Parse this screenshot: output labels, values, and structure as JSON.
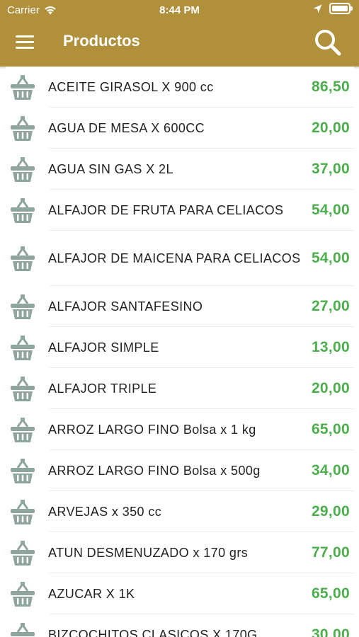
{
  "status_bar": {
    "carrier": "Carrier",
    "time": "8:44 PM"
  },
  "navbar": {
    "title": "Productos",
    "menu_icon": "hamburger-menu-icon",
    "search_icon": "search-icon"
  },
  "colors": {
    "header": "#b1903c",
    "price": "#4cae4c",
    "basket_icon": "#8fa59f"
  },
  "products": [
    {
      "name": "ACEITE GIRASOL X 900 cc",
      "price": "86,50"
    },
    {
      "name": "AGUA DE MESA X 600CC",
      "price": "20,00"
    },
    {
      "name": "AGUA SIN GAS X 2L",
      "price": "37,00"
    },
    {
      "name": "ALFAJOR DE FRUTA PARA CELIACOS",
      "price": "54,00"
    },
    {
      "name": "ALFAJOR DE MAICENA PARA CELIACOS",
      "price": "54,00"
    },
    {
      "name": "ALFAJOR SANTAFESINO",
      "price": "27,00"
    },
    {
      "name": "ALFAJOR SIMPLE",
      "price": "13,00"
    },
    {
      "name": "ALFAJOR TRIPLE",
      "price": "20,00"
    },
    {
      "name": "ARROZ LARGO FINO Bolsa x 1 kg",
      "price": "65,00"
    },
    {
      "name": "ARROZ LARGO FINO Bolsa x 500g",
      "price": "34,00"
    },
    {
      "name": "ARVEJAS x 350 cc",
      "price": "29,00"
    },
    {
      "name": "ATUN DESMENUZADO x 170 grs",
      "price": "77,00"
    },
    {
      "name": "AZUCAR X 1K",
      "price": "65,00"
    },
    {
      "name": "BIZCOCHITOS CLASICOS X 170G",
      "price": "30,00"
    }
  ]
}
